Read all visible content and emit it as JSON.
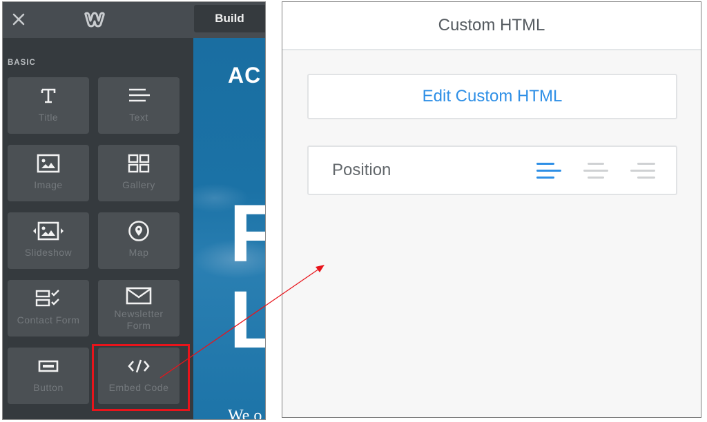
{
  "editor": {
    "topbar": {
      "close_icon": "close-icon",
      "logo_icon": "weebly-w-logo",
      "build_tab_label": "Build"
    },
    "sidebar": {
      "section_label": "BASIC",
      "elements": [
        {
          "label": "Title",
          "icon": "title-T-icon"
        },
        {
          "label": "Text",
          "icon": "text-lines-icon"
        },
        {
          "label": "Image",
          "icon": "image-icon"
        },
        {
          "label": "Gallery",
          "icon": "gallery-grid-icon"
        },
        {
          "label": "Slideshow",
          "icon": "slideshow-icon"
        },
        {
          "label": "Map",
          "icon": "map-pin-icon"
        },
        {
          "label": "Contact Form",
          "icon": "contact-form-icon"
        },
        {
          "label": "Newsletter Form",
          "icon": "envelope-icon"
        },
        {
          "label": "Button",
          "icon": "button-icon"
        },
        {
          "label": "Embed Code",
          "icon": "code-icon",
          "highlighted": true
        }
      ]
    },
    "canvas_preview": {
      "heading_fragment": "AC",
      "big_letter_1": "F",
      "big_letter_2": "L",
      "tagline_fragment": "We o"
    }
  },
  "settings_panel": {
    "title": "Custom HTML",
    "edit_button_label": "Edit Custom HTML",
    "position": {
      "label": "Position",
      "options": [
        "left",
        "center",
        "right"
      ],
      "selected": "left"
    }
  },
  "colors": {
    "accent_blue": "#2e8fe6",
    "highlight_red": "#e8141b",
    "sidebar_bg": "#353a3e",
    "tile_bg": "#4b5054"
  }
}
